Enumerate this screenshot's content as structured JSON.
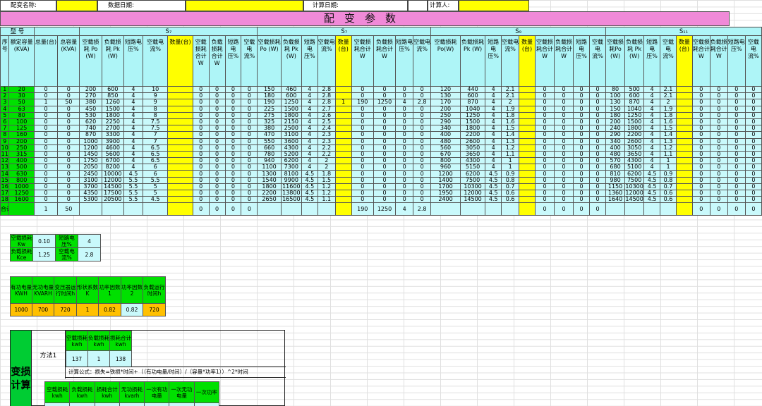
{
  "header": {
    "name_label": "配变名称:",
    "date_label": "数据日期:",
    "calc_date_label": "计算日期:",
    "calculator_label": "计算人:"
  },
  "title": "配变参数",
  "table": {
    "model_label": "型 号",
    "groups": [
      "S₇",
      "S₇",
      "S₉",
      "S₁₁"
    ],
    "col_seq": "序号",
    "col_rated": "额定容量(KVA)",
    "col_total_count": "总量(台)",
    "col_total_cap": "总容量(KVA)",
    "col_s7a": [
      "空载损耗 Po (W)",
      "负载损耗 Pk (W)",
      "短路电压%",
      "空载电流%",
      "数量(台)",
      "空载损耗合计 W",
      "负载损耗合计 W",
      "短路电压%",
      "空载电流%"
    ],
    "col_s7b": [
      "空载损耗 Po (W)",
      "负载损耗 Pk (W)",
      "短路电压%",
      "空载电流%",
      "数量(台)",
      "空载损耗合计 W",
      "负载损耗合计 W",
      "短路电压%",
      "空载电流%"
    ],
    "col_s9": [
      "空载损耗Po(W)",
      "负载损耗 Pk (W)",
      "短路电压%",
      "空载电流%",
      "数量(台)",
      "空载损耗合计 W",
      "负载损耗合计 W",
      "短路电压%",
      "空载电流%"
    ],
    "col_s11": [
      "空载损耗Po (W)",
      "负载损耗 Pk (W)",
      "短路电压%",
      "空载电流%",
      "数量(台)",
      "空载损耗合计 W",
      "负载损耗合计 W",
      "短路电压%",
      "空载电流%"
    ],
    "rows": [
      [
        "1",
        "20",
        "0",
        "0",
        "200",
        "600",
        "4",
        "10",
        "",
        "0",
        "0",
        "0",
        "0",
        "150",
        "460",
        "4",
        "2.8",
        "",
        "0",
        "0",
        "0",
        "0",
        "120",
        "440",
        "4",
        "2.1",
        "",
        "0",
        "0",
        "0",
        "0",
        "80",
        "500",
        "4",
        "2.1",
        "",
        "0",
        "0",
        "0",
        "0"
      ],
      [
        "2",
        "30",
        "0",
        "0",
        "270",
        "850",
        "4",
        "9",
        "",
        "0",
        "0",
        "0",
        "0",
        "180",
        "600",
        "4",
        "2.8",
        "",
        "0",
        "0",
        "0",
        "0",
        "130",
        "600",
        "4",
        "2.1",
        "",
        "0",
        "0",
        "0",
        "0",
        "100",
        "600",
        "4",
        "2.1",
        "",
        "0",
        "0",
        "0",
        "0"
      ],
      [
        "3",
        "50",
        "1",
        "50",
        "380",
        "1260",
        "4",
        "9",
        "",
        "0",
        "0",
        "0",
        "0",
        "190",
        "1250",
        "4",
        "2.8",
        "1",
        "190",
        "1250",
        "4",
        "2.8",
        "170",
        "870",
        "4",
        "2",
        "",
        "0",
        "0",
        "0",
        "0",
        "130",
        "870",
        "4",
        "2",
        "",
        "0",
        "0",
        "0",
        "0"
      ],
      [
        "4",
        "63",
        "0",
        "0",
        "450",
        "1500",
        "4",
        "8",
        "",
        "0",
        "0",
        "0",
        "0",
        "225",
        "1500",
        "4",
        "2.7",
        "",
        "0",
        "0",
        "0",
        "0",
        "200",
        "1040",
        "4",
        "1.9",
        "",
        "0",
        "0",
        "0",
        "0",
        "150",
        "1040",
        "4",
        "1.9",
        "",
        "0",
        "0",
        "0",
        "0"
      ],
      [
        "5",
        "80",
        "0",
        "0",
        "530",
        "1800",
        "4",
        "8",
        "",
        "0",
        "0",
        "0",
        "0",
        "275",
        "1800",
        "4",
        "2.6",
        "",
        "0",
        "0",
        "0",
        "0",
        "250",
        "1250",
        "4",
        "1.8",
        "",
        "0",
        "0",
        "0",
        "0",
        "180",
        "1250",
        "4",
        "1.8",
        "",
        "0",
        "0",
        "0",
        "0"
      ],
      [
        "6",
        "100",
        "0",
        "0",
        "620",
        "2250",
        "4",
        "7.5",
        "",
        "0",
        "0",
        "0",
        "0",
        "325",
        "2150",
        "4",
        "2.5",
        "",
        "0",
        "0",
        "0",
        "0",
        "290",
        "1500",
        "4",
        "1.6",
        "",
        "0",
        "0",
        "0",
        "0",
        "200",
        "1500",
        "4",
        "1.6",
        "",
        "0",
        "0",
        "0",
        "0"
      ],
      [
        "7",
        "125",
        "0",
        "0",
        "740",
        "2700",
        "4",
        "7.5",
        "",
        "0",
        "0",
        "0",
        "0",
        "380",
        "2500",
        "4",
        "2.4",
        "",
        "0",
        "0",
        "0",
        "0",
        "340",
        "1800",
        "4",
        "1.5",
        "",
        "0",
        "0",
        "0",
        "0",
        "240",
        "1800",
        "4",
        "1.5",
        "",
        "0",
        "0",
        "0",
        "0"
      ],
      [
        "8",
        "160",
        "0",
        "0",
        "870",
        "3300",
        "4",
        "7",
        "",
        "0",
        "0",
        "0",
        "0",
        "470",
        "3100",
        "4",
        "2.3",
        "",
        "0",
        "0",
        "0",
        "0",
        "400",
        "2200",
        "4",
        "1.4",
        "",
        "0",
        "0",
        "0",
        "0",
        "290",
        "2200",
        "4",
        "1.4",
        "",
        "0",
        "0",
        "0",
        "0"
      ],
      [
        "9",
        "200",
        "0",
        "0",
        "1000",
        "3900",
        "4",
        "7",
        "",
        "0",
        "0",
        "0",
        "0",
        "550",
        "3600",
        "4",
        "2.3",
        "",
        "0",
        "0",
        "0",
        "0",
        "480",
        "2600",
        "4",
        "1.3",
        "",
        "0",
        "0",
        "0",
        "0",
        "340",
        "2600",
        "4",
        "1.3",
        "",
        "0",
        "0",
        "0",
        "0"
      ],
      [
        "10",
        "250",
        "0",
        "0",
        "1200",
        "4600",
        "4",
        "6.5",
        "",
        "0",
        "0",
        "0",
        "0",
        "660",
        "4300",
        "4",
        "2.2",
        "",
        "0",
        "0",
        "0",
        "0",
        "560",
        "3050",
        "4",
        "1.2",
        "",
        "0",
        "0",
        "0",
        "0",
        "400",
        "3050",
        "4",
        "1.2",
        "",
        "0",
        "0",
        "0",
        "0"
      ],
      [
        "11",
        "315",
        "0",
        "0",
        "1450",
        "5600",
        "4",
        "6.5",
        "",
        "0",
        "0",
        "0",
        "0",
        "780",
        "5200",
        "4",
        "2.2",
        "",
        "0",
        "0",
        "0",
        "0",
        "670",
        "3650",
        "4",
        "1.1",
        "",
        "0",
        "0",
        "0",
        "0",
        "480",
        "3650",
        "4",
        "1.1",
        "",
        "0",
        "0",
        "0",
        "0"
      ],
      [
        "12",
        "400",
        "0",
        "0",
        "1750",
        "6700",
        "4",
        "6.5",
        "",
        "0",
        "0",
        "0",
        "0",
        "940",
        "6200",
        "4",
        "2",
        "",
        "0",
        "0",
        "0",
        "0",
        "800",
        "4300",
        "4",
        "1",
        "",
        "0",
        "0",
        "0",
        "0",
        "570",
        "4300",
        "4",
        "1",
        "",
        "0",
        "0",
        "0",
        "0"
      ],
      [
        "13",
        "500",
        "0",
        "0",
        "2050",
        "8200",
        "4",
        "6",
        "",
        "0",
        "0",
        "0",
        "0",
        "1100",
        "7300",
        "4",
        "2",
        "",
        "0",
        "0",
        "0",
        "0",
        "960",
        "5150",
        "4",
        "1",
        "",
        "0",
        "0",
        "0",
        "0",
        "680",
        "5100",
        "4",
        "1",
        "",
        "0",
        "0",
        "0",
        "0"
      ],
      [
        "14",
        "630",
        "0",
        "0",
        "2450",
        "10000",
        "4.5",
        "6",
        "",
        "0",
        "0",
        "0",
        "0",
        "1300",
        "8100",
        "4.5",
        "1.8",
        "",
        "0",
        "0",
        "0",
        "0",
        "1200",
        "6200",
        "4.5",
        "0.9",
        "",
        "0",
        "0",
        "0",
        "0",
        "810",
        "6200",
        "4.5",
        "0.9",
        "",
        "0",
        "0",
        "0",
        "0"
      ],
      [
        "15",
        "800",
        "0",
        "0",
        "3100",
        "12000",
        "5.5",
        "5.5",
        "",
        "0",
        "0",
        "0",
        "0",
        "1540",
        "9900",
        "4.5",
        "1.5",
        "",
        "0",
        "0",
        "0",
        "0",
        "1400",
        "7500",
        "4.5",
        "0.8",
        "",
        "0",
        "0",
        "0",
        "0",
        "980",
        "7500",
        "4.5",
        "0.8",
        "",
        "0",
        "0",
        "0",
        "0"
      ],
      [
        "16",
        "1000",
        "0",
        "0",
        "3700",
        "14500",
        "5.5",
        "5",
        "",
        "0",
        "0",
        "0",
        "0",
        "1800",
        "11600",
        "4.5",
        "1.2",
        "",
        "0",
        "0",
        "0",
        "0",
        "1700",
        "10300",
        "4.5",
        "0.7",
        "",
        "0",
        "0",
        "0",
        "0",
        "1150",
        "10300",
        "4.5",
        "0.7",
        "",
        "0",
        "0",
        "0",
        "0"
      ],
      [
        "17",
        "1250",
        "0",
        "0",
        "4350",
        "17500",
        "5.5",
        "5",
        "",
        "0",
        "0",
        "0",
        "0",
        "2200",
        "13800",
        "4.5",
        "1.2",
        "",
        "0",
        "0",
        "0",
        "0",
        "1950",
        "12000",
        "4.5",
        "0.6",
        "",
        "0",
        "0",
        "0",
        "0",
        "1360",
        "12000",
        "4.5",
        "0.6",
        "",
        "0",
        "0",
        "0",
        "0"
      ],
      [
        "18",
        "1600",
        "0",
        "0",
        "5300",
        "20500",
        "5.5",
        "4.5",
        "",
        "0",
        "0",
        "0",
        "0",
        "2650",
        "16500",
        "4.5",
        "1.1",
        "",
        "0",
        "0",
        "0",
        "0",
        "2400",
        "14500",
        "4.5",
        "0.6",
        "",
        "0",
        "0",
        "0",
        "0",
        "1640",
        "14500",
        "4.5",
        "0.6",
        "",
        "0",
        "0",
        "0",
        "0"
      ]
    ],
    "total_row": [
      "合计",
      "",
      "1",
      "50",
      "",
      "",
      "",
      "",
      "",
      "0",
      "0",
      "0",
      "0",
      "",
      "",
      "",
      "",
      "",
      "190",
      "1250",
      "4",
      "2.8",
      "",
      "",
      "",
      "",
      "",
      "0",
      "0",
      "0",
      "0",
      "",
      "",
      "",
      "",
      "",
      "0",
      "0",
      "0",
      "0"
    ]
  },
  "params": {
    "r1": [
      "空载损耗 Kw",
      "0.10",
      "短路电压%",
      "4"
    ],
    "r2": [
      "负载损耗 Kce",
      "1.25",
      "空载电流%",
      "2.8"
    ]
  },
  "energy": {
    "headers": [
      "有功电量KWH",
      "无功电量KVARH",
      "变压器运行时间h",
      "形状系数K",
      "功率因数1",
      "功率因数2",
      "负载运行时间h"
    ],
    "values": [
      "1000",
      "700",
      "720",
      "1",
      "0.82",
      "0.82",
      "720"
    ]
  },
  "calc": {
    "big_title": "变损计算",
    "method1": "方法1",
    "h1": [
      "空载损耗kwh",
      "负载损耗kwh",
      "损耗合计kwh"
    ],
    "v1": [
      "137",
      "1",
      "138"
    ],
    "formula": "计算公式：损失=铁损*时间+（（有功电量/时间）/（容量*功率1））^2*时间",
    "h2": [
      "空载损耗kwh",
      "负载损耗kwh",
      "损耗合计kwh",
      "无功损耗kvarh",
      "一次有功电量",
      "一次无功电量",
      "一次功率"
    ]
  }
}
